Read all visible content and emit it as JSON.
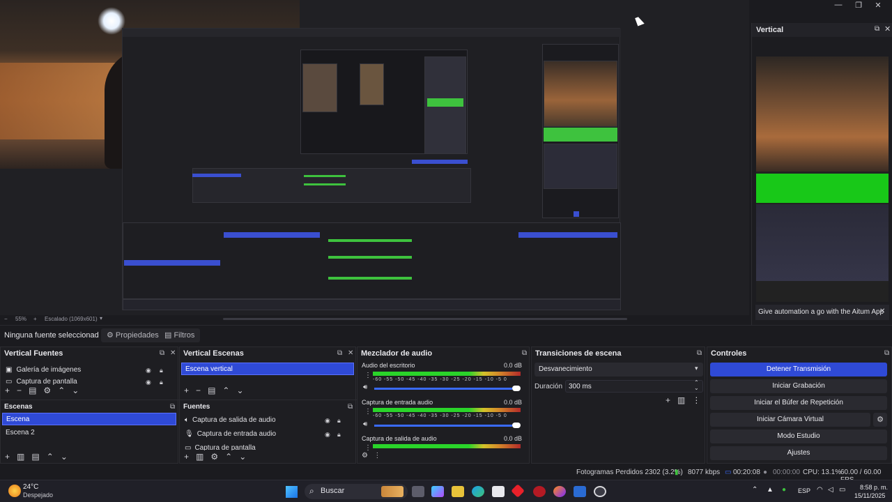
{
  "window": {
    "minimize": "—",
    "maximize": "❐",
    "close": "✕"
  },
  "vertical_dock": {
    "title": "Vertical",
    "notice": "Give automation a go with the Aitum App",
    "notice_close": "✕"
  },
  "preview": {
    "zoom": "55%",
    "scale_label": "Escalado (1069x601)"
  },
  "source_bar": {
    "no_source": "Ninguna fuente seleccionad",
    "properties": "Propiedades",
    "filters": "Filtros"
  },
  "vertical_sources": {
    "title": "Vertical Fuentes",
    "items": [
      {
        "label": "Galería de imágenes"
      },
      {
        "label": "Captura de pantalla"
      }
    ]
  },
  "scenes": {
    "title": "Escenas",
    "items": [
      {
        "label": "Escena",
        "selected": true
      },
      {
        "label": "Escena 2",
        "selected": false
      }
    ]
  },
  "vertical_scenes": {
    "title": "Vertical Escenas",
    "items": [
      {
        "label": "Escena vertical",
        "selected": true
      }
    ]
  },
  "sources": {
    "title": "Fuentes",
    "items": [
      {
        "label": "Captura de salida de audio"
      },
      {
        "label": "Captura de entrada audio"
      },
      {
        "label": "Captura de pantalla"
      }
    ]
  },
  "mixer": {
    "title": "Mezclador de audio",
    "scale": "-60 -55 -50 -45 -40 -35 -30 -25 -20 -15 -10 -5 0",
    "channels": [
      {
        "name": "Audio del escritorio",
        "db": "0.0 dB",
        "volume": 1.0
      },
      {
        "name": "Captura de entrada audio",
        "db": "0.0 dB",
        "volume": 1.0
      },
      {
        "name": "Captura de salida de audio",
        "db": "0.0 dB",
        "volume": 1.0
      }
    ]
  },
  "transitions": {
    "title": "Transiciones de escena",
    "selected": "Desvanecimiento",
    "duration_label": "Duración",
    "duration_value": "300 ms"
  },
  "controls": {
    "title": "Controles",
    "buttons": [
      "Detener Transmisión",
      "Iniciar Grabación",
      "Iniciar el Búfer de Repetición",
      "Iniciar Cámara Virtual",
      "Modo Estudio",
      "Ajustes"
    ]
  },
  "status": {
    "dropped_frames": "Fotogramas Perdidos 2302 (3.2%)",
    "bitrate": "8077 kbps",
    "stream_time": "00:20:08",
    "rec_time": "00:00:00",
    "cpu": "CPU: 13.1%",
    "fps": "60.00 / 60.00 FPS"
  },
  "taskbar": {
    "weather_temp": "24°C",
    "weather_desc": "Despejado",
    "search": "Buscar",
    "lang": "ESP",
    "time": "8:58 p. m.",
    "date": "15/11/2025"
  },
  "colors": {
    "accent": "#2f4ad6",
    "meter_green": "#2ad42a",
    "bg": "#1b1b1f"
  }
}
